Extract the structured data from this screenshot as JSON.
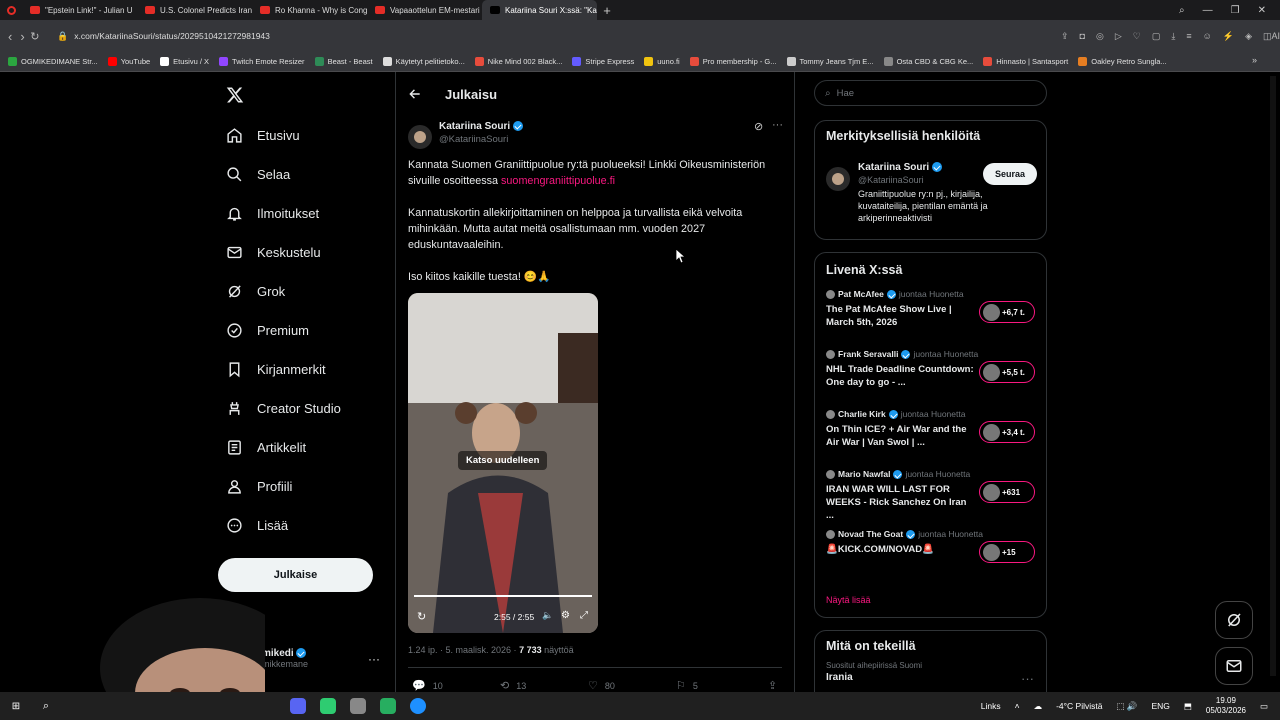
{
  "browser": {
    "tabs": [
      {
        "label": "\"Epstein Link!\" - Julian U"
      },
      {
        "label": "U.S. Colonel Predicts Iran"
      },
      {
        "label": "Ro Khanna - Why is Cong"
      },
      {
        "label": "Vapaaottelun EM-mestari"
      },
      {
        "label": "Katariina Souri X:ssä: \"Kan",
        "active": true
      }
    ],
    "url": "x.com/KatariinaSouri/status/2029510421272981943",
    "bookmarks": [
      {
        "label": "OGMIKEDIMANE Str...",
        "color": "#2ba640"
      },
      {
        "label": "YouTube",
        "color": "#ff0000"
      },
      {
        "label": "Etusivu / X",
        "color": "#ffffff"
      },
      {
        "label": "Twitch Emote Resizer",
        "color": "#9146ff"
      },
      {
        "label": "Beast - Beast",
        "color": "#2e8b57"
      },
      {
        "label": "Käytetyt pelitietoko...",
        "color": "#dddddd"
      },
      {
        "label": "Nike Mind 002 Black...",
        "color": "#e74c3c"
      },
      {
        "label": "Stripe Express",
        "color": "#635bff"
      },
      {
        "label": "uuno.fi",
        "color": "#f1c40f"
      },
      {
        "label": "Pro membership - G...",
        "color": "#e74c3c"
      },
      {
        "label": "Tommy Jeans Tjm E...",
        "color": "#cccccc"
      },
      {
        "label": "Osta CBD & CBG Ke...",
        "color": "#888888"
      },
      {
        "label": "Hinnasto | Santasport",
        "color": "#e74c3c"
      },
      {
        "label": "Oakley Retro Sungla...",
        "color": "#e67e22"
      }
    ]
  },
  "nav": {
    "items": [
      {
        "label": "Etusivu",
        "icon": "home-icon"
      },
      {
        "label": "Selaa",
        "icon": "search-icon"
      },
      {
        "label": "Ilmoitukset",
        "icon": "bell-icon"
      },
      {
        "label": "Keskustelu",
        "icon": "mail-icon"
      },
      {
        "label": "Grok",
        "icon": "grok-icon"
      },
      {
        "label": "Premium",
        "icon": "premium-icon"
      },
      {
        "label": "Kirjanmerkit",
        "icon": "bookmark-icon"
      },
      {
        "label": "Creator Studio",
        "icon": "creator-icon"
      },
      {
        "label": "Artikkelit",
        "icon": "article-icon"
      },
      {
        "label": "Profiili",
        "icon": "profile-icon"
      },
      {
        "label": "Lisää",
        "icon": "more-icon"
      }
    ],
    "post_button": "Julkaise",
    "account_name": "mikedi",
    "account_handle": "mikkemane"
  },
  "main": {
    "header_title": "Julkaisu",
    "author_name": "Katariina Souri",
    "author_handle": "@KatariinaSouri",
    "text1": "Kannata Suomen Graniittipuolue ry:tä puolueeksi! Linkki Oikeusministeriön sivuille osoitteessa",
    "link": "suomengraniittipuolue.fi",
    "text2": "Kannatuskortin allekirjoittaminen on helppoa ja turvallista eikä velvoita mihinkään. Mutta autat meitä osallistumaan mm. vuoden 2027 eduskuntavaaleihin.",
    "text3": "Iso kiitos kaikille tuesta! 😊🙏",
    "video": {
      "replay_label": "Katso uudelleen",
      "time": "2:55 / 2:55",
      "progress": 1.0
    },
    "meta_time": "1.24 ip. · 5. maalisk. 2026 · ",
    "views": "7 733",
    "views_label": " näyttöä",
    "replies": "10",
    "reposts": "13",
    "likes": "80",
    "bookmarks": "5"
  },
  "side": {
    "search_placeholder": "Hae",
    "relevant_title": "Merkityksellisiä henkilöitä",
    "rel_name": "Katariina Souri",
    "rel_handle": "@KatariinaSouri",
    "rel_bio": "Graniittipuolue ry:n pj., kirjailija, kuvataiteilija, pientilan emäntä ja arkiperinneaktivisti",
    "follow_label": "Seuraa",
    "live_title": "Livenä X:ssä",
    "live": [
      {
        "host": "Pat McAfee",
        "role": "juontaa Huonetta",
        "title": "The Pat McAfee Show Live | March 5th, 2026",
        "count": "+6,7 t."
      },
      {
        "host": "Frank Seravalli",
        "role": "juontaa Huonetta",
        "title": "NHL Trade Deadline Countdown: One day to go - ...",
        "count": "+5,5 t."
      },
      {
        "host": "Charlie Kirk",
        "role": "juontaa Huonetta",
        "title": "On Thin ICE? + Air War and the Air War | Van Swol | ...",
        "count": "+3,4 t."
      },
      {
        "host": "Mario Nawfal",
        "role": "juontaa Huonetta",
        "title": "IRAN WAR WILL LAST FOR WEEKS - Rick Sanchez On Iran ...",
        "count": "+631"
      },
      {
        "host": "Novad The Goat",
        "role": "juontaa Huonetta",
        "title": "🚨KICK.COM/NOVAD🚨",
        "count": "+15"
      }
    ],
    "show_more": "Näytä lisää",
    "happening_title": "Mitä on tekeillä",
    "trend_context": "Suositut aihepiirissä Suomi",
    "trend_name": "Irania"
  },
  "taskbar": {
    "links": "Links",
    "weather": "-4°C Pilvistä",
    "lang": "ENG",
    "time": "19.09",
    "date": "05/03/2026"
  }
}
